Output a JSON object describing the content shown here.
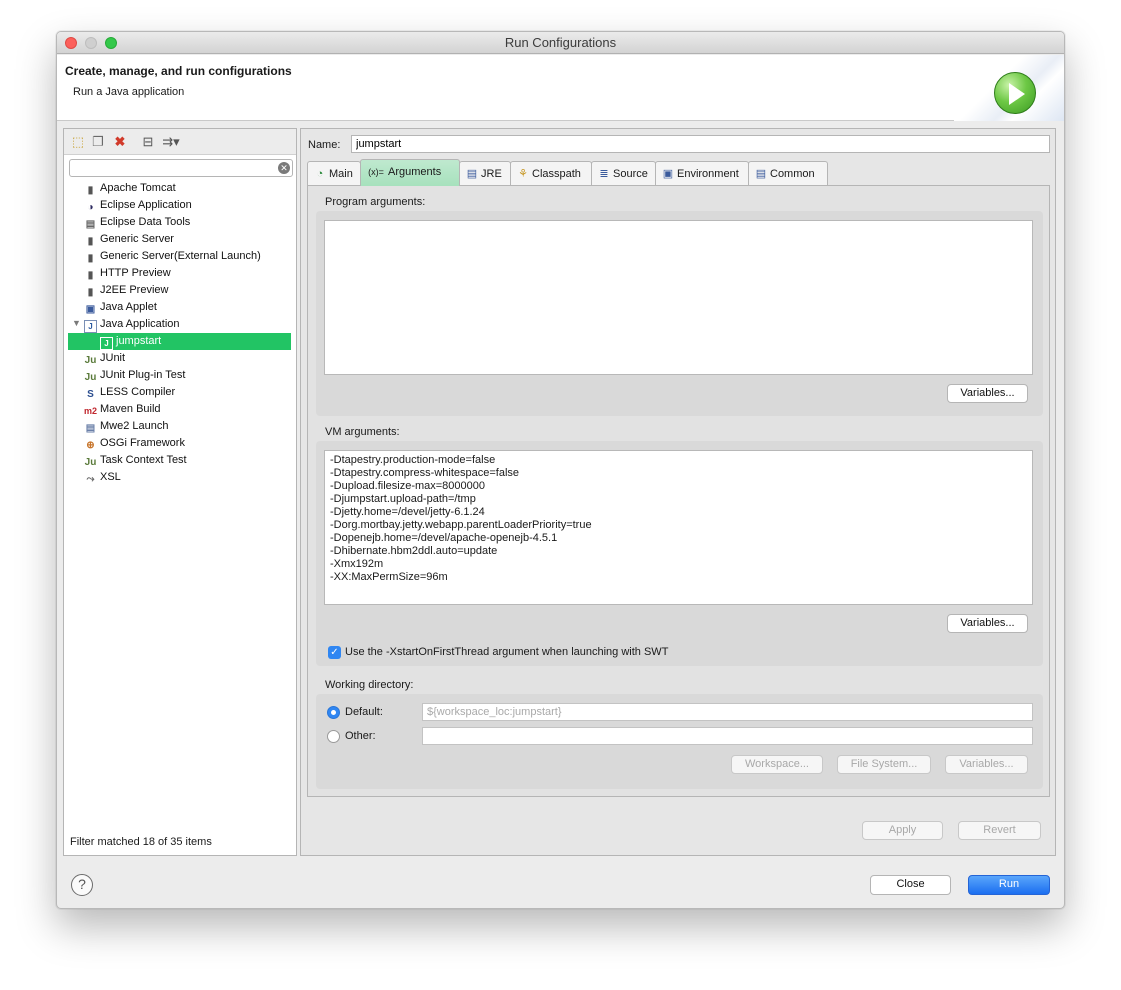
{
  "window": {
    "title": "Run Configurations",
    "header_title": "Create, manage, and run configurations",
    "header_subtitle": "Run a Java application"
  },
  "toolbar": {
    "icons": [
      "new-configuration-icon",
      "duplicate-icon",
      "delete-icon",
      "collapse-all-icon",
      "filter-icon"
    ]
  },
  "filter": {
    "placeholder": "",
    "status": "Filter matched 18 of 35 items"
  },
  "tree": {
    "items": [
      {
        "label": "Apache Tomcat",
        "icon": "tomcat-icon"
      },
      {
        "label": "Eclipse Application",
        "icon": "eclipse-icon"
      },
      {
        "label": "Eclipse Data Tools",
        "icon": "database-icon"
      },
      {
        "label": "Generic Server",
        "icon": "server-icon"
      },
      {
        "label": "Generic Server(External Launch)",
        "icon": "server-icon"
      },
      {
        "label": "HTTP Preview",
        "icon": "server-icon"
      },
      {
        "label": "J2EE Preview",
        "icon": "server-icon"
      },
      {
        "label": "Java Applet",
        "icon": "applet-icon"
      },
      {
        "label": "Java Application",
        "icon": "java-app-icon"
      },
      {
        "label": "jumpstart",
        "icon": "java-app-icon"
      },
      {
        "label": "JUnit",
        "icon": "junit-icon"
      },
      {
        "label": "JUnit Plug-in Test",
        "icon": "junit-plugin-icon"
      },
      {
        "label": "LESS Compiler",
        "icon": "less-icon"
      },
      {
        "label": "Maven Build",
        "icon": "maven-icon"
      },
      {
        "label": "Mwe2 Launch",
        "icon": "mwe2-icon"
      },
      {
        "label": "OSGi Framework",
        "icon": "osgi-icon"
      },
      {
        "label": "Task Context Test",
        "icon": "task-icon"
      },
      {
        "label": "XSL",
        "icon": "xsl-icon"
      }
    ]
  },
  "config": {
    "name_label": "Name:",
    "name_value": "jumpstart"
  },
  "tabs": [
    {
      "label": "Main",
      "icon": "main-tab-icon"
    },
    {
      "label": "Arguments",
      "icon": "arguments-tab-icon"
    },
    {
      "label": "JRE",
      "icon": "jre-tab-icon"
    },
    {
      "label": "Classpath",
      "icon": "classpath-tab-icon"
    },
    {
      "label": "Source",
      "icon": "source-tab-icon"
    },
    {
      "label": "Environment",
      "icon": "environment-tab-icon"
    },
    {
      "label": "Common",
      "icon": "common-tab-icon"
    }
  ],
  "arguments": {
    "program_label": "Program arguments:",
    "program_value": "",
    "variables_label": "Variables...",
    "vm_label": "VM arguments:",
    "vm_value": "-Dtapestry.production-mode=false\n-Dtapestry.compress-whitespace=false\n-Dupload.filesize-max=8000000\n-Djumpstart.upload-path=/tmp\n-Djetty.home=/devel/jetty-6.1.24\n-Dorg.mortbay.jetty.webapp.parentLoaderPriority=true\n-Dopenejb.home=/devel/apache-openejb-4.5.1\n-Dhibernate.hbm2ddl.auto=update\n-Xmx192m\n-XX:MaxPermSize=96m",
    "swt_checkbox_label": "Use the -XstartOnFirstThread argument when launching with SWT",
    "swt_checked": true
  },
  "working_directory": {
    "label": "Working directory:",
    "default_label": "Default:",
    "default_value": "${workspace_loc:jumpstart}",
    "other_label": "Other:",
    "other_value": "",
    "workspace_button": "Workspace...",
    "filesystem_button": "File System...",
    "variables_button": "Variables..."
  },
  "footer": {
    "apply": "Apply",
    "revert": "Revert",
    "close": "Close",
    "run": "Run",
    "help_glyph": "?"
  },
  "colors": {
    "selection": "#22c464",
    "active_tab": "#a7e1bd",
    "accent_blue": "#1b6ef0"
  }
}
